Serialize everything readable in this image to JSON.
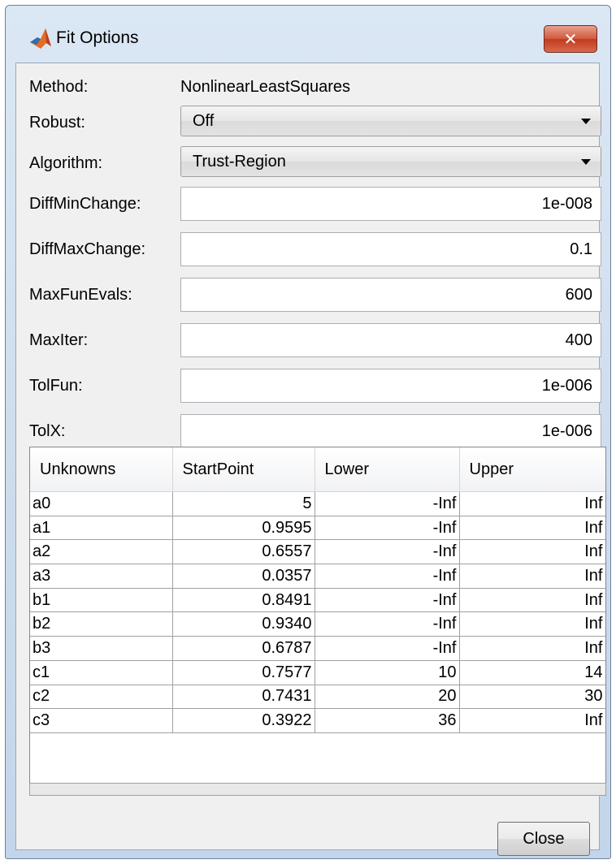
{
  "window": {
    "title": "Fit Options",
    "icon": "matlab-logo-icon",
    "close_glyph": "✕"
  },
  "form": {
    "method": {
      "label": "Method:",
      "value": "NonlinearLeastSquares"
    },
    "robust": {
      "label": "Robust:",
      "value": "Off"
    },
    "algorithm": {
      "label": "Algorithm:",
      "value": "Trust-Region"
    },
    "diff_min_change": {
      "label": "DiffMinChange:",
      "value": "1e-008"
    },
    "diff_max_change": {
      "label": "DiffMaxChange:",
      "value": "0.1"
    },
    "max_fun_evals": {
      "label": "MaxFunEvals:",
      "value": "600"
    },
    "max_iter": {
      "label": "MaxIter:",
      "value": "400"
    },
    "tol_fun": {
      "label": "TolFun:",
      "value": "1e-006"
    },
    "tol_x": {
      "label": "TolX:",
      "value": "1e-006"
    }
  },
  "table": {
    "columns": [
      "Unknowns",
      "StartPoint",
      "Lower",
      "Upper"
    ],
    "rows": [
      [
        "a0",
        "5",
        "-Inf",
        "Inf"
      ],
      [
        "a1",
        "0.9595",
        "-Inf",
        "Inf"
      ],
      [
        "a2",
        "0.6557",
        "-Inf",
        "Inf"
      ],
      [
        "a3",
        "0.0357",
        "-Inf",
        "Inf"
      ],
      [
        "b1",
        "0.8491",
        "-Inf",
        "Inf"
      ],
      [
        "b2",
        "0.9340",
        "-Inf",
        "Inf"
      ],
      [
        "b3",
        "0.6787",
        "-Inf",
        "Inf"
      ],
      [
        "c1",
        "0.7577",
        "10",
        "14"
      ],
      [
        "c2",
        "0.7431",
        "20",
        "30"
      ],
      [
        "c3",
        "0.3922",
        "36",
        "Inf"
      ]
    ]
  },
  "footer": {
    "close_label": "Close"
  }
}
